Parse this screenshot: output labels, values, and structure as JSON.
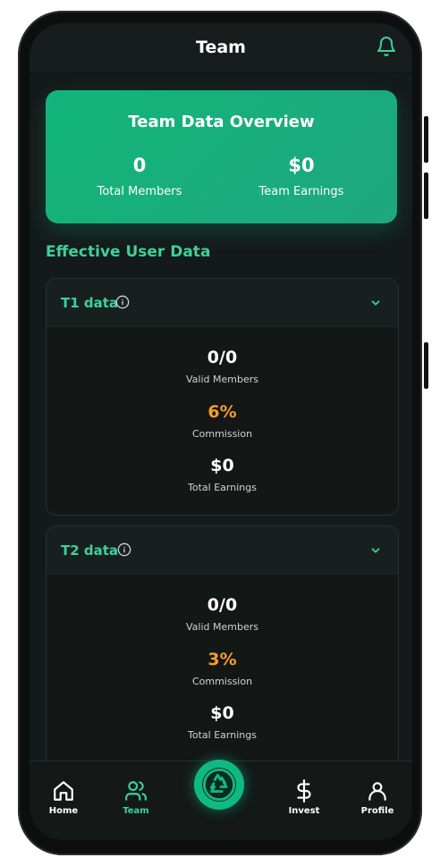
{
  "header": {
    "title": "Team",
    "notification_icon": "bell-icon"
  },
  "overview": {
    "title": "Team Data Overview",
    "total_members_value": "0",
    "total_members_label": "Total Members",
    "team_earnings_value": "$0",
    "team_earnings_label": "Team Earnings"
  },
  "section_title": "Effective User Data",
  "tiers": [
    {
      "label": "T1 data",
      "valid_members_value": "0/0",
      "valid_members_label": "Valid Members",
      "commission_value": "6%",
      "commission_label": "Commission",
      "earnings_value": "$0",
      "earnings_label": "Total Earnings"
    },
    {
      "label": "T2 data",
      "valid_members_value": "0/0",
      "valid_members_label": "Valid Members",
      "commission_value": "3%",
      "commission_label": "Commission",
      "earnings_value": "$0",
      "earnings_label": "Total Earnings"
    }
  ],
  "nav": {
    "items": [
      {
        "label": "Home",
        "icon": "home-icon"
      },
      {
        "label": "Team",
        "icon": "users-icon",
        "active": true
      },
      {
        "label": "",
        "icon": "recycle-icon"
      },
      {
        "label": "Invest",
        "icon": "dollar-icon"
      },
      {
        "label": "Profile",
        "icon": "user-icon"
      }
    ]
  },
  "colors": {
    "accent": "#3ed09c",
    "accent_bg": "#12b57b",
    "commission": "#f59e2b",
    "background": "#141a19"
  }
}
